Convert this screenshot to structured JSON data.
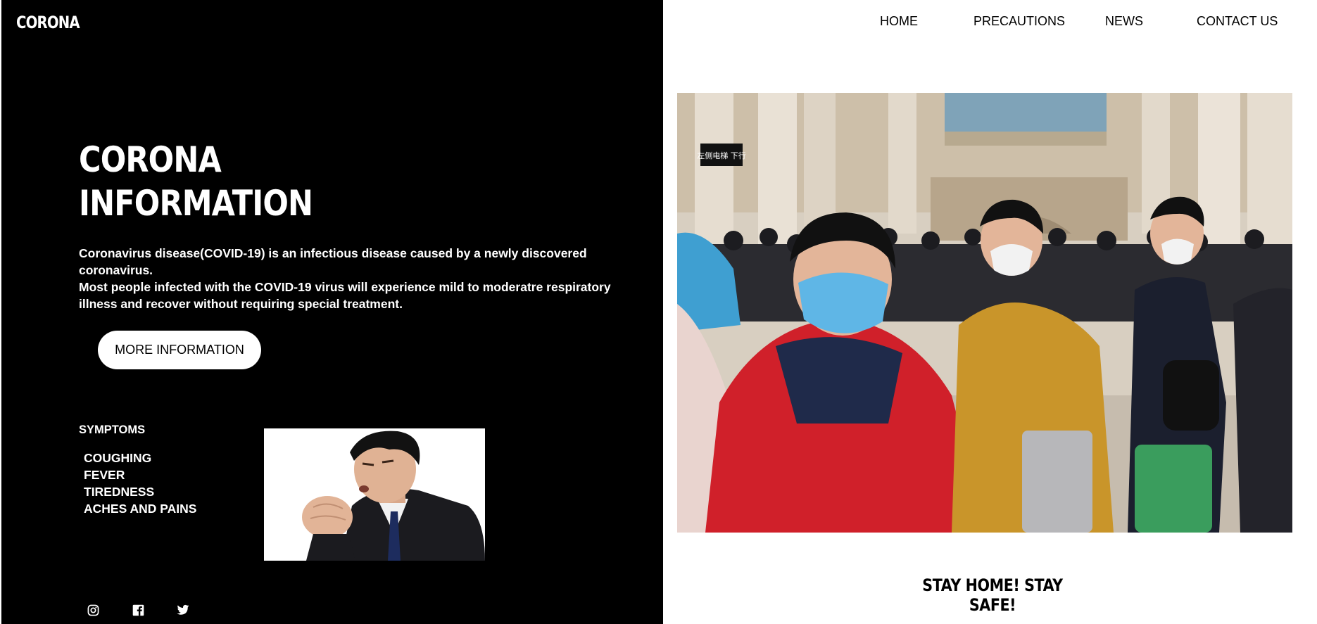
{
  "brand": {
    "logo": "CORONA"
  },
  "nav": {
    "home": "HOME",
    "precautions": "PRECAUTIONS",
    "news": "NEWS",
    "contact": "CONTACT US"
  },
  "hero": {
    "title_line1": "CORONA",
    "title_line2": "INFORMATION",
    "text_line1": "Coronavirus disease(COVID-19) is an infectious disease caused by a newly discovered coronavirus.",
    "text_line2": "Most people infected with the COVID-19 virus will experience mild to moderatre respiratory",
    "text_line3": "illness and recover without requiring special treatment.",
    "button_label": "MORE INFORMATION"
  },
  "symptoms": {
    "heading": "SYMPTOMS",
    "items": [
      "COUGHING",
      "FEVER",
      "TIREDNESS",
      "ACHES AND PAINS"
    ]
  },
  "social": {
    "icons": [
      "instagram-icon",
      "facebook-icon",
      "twitter-icon"
    ]
  },
  "photo": {
    "sign_text": "左侧电梯 下行"
  },
  "footer": {
    "tagline": "STAY HOME! STAY SAFE!"
  },
  "colors": {
    "panel": "#000000",
    "page": "#ffffff",
    "text_light": "#ffffff",
    "text_dark": "#000000"
  }
}
